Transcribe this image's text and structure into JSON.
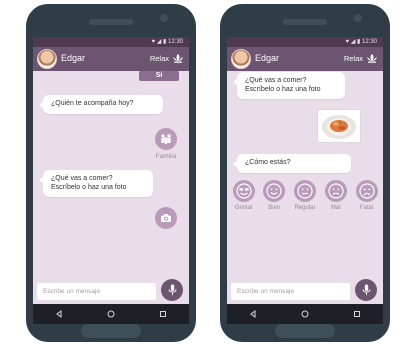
{
  "status": {
    "time": "12:30"
  },
  "header": {
    "contact_name": "Edgar",
    "mode_label": "Relax"
  },
  "left": {
    "reply_chip": "Sí",
    "bubble_1": "¿Quién te acompaña hoy?",
    "family_label": "Familia",
    "bubble_2_line1": "¿Qué vas a comer?",
    "bubble_2_line2": "Escríbelo o haz una foto"
  },
  "right": {
    "bubble_1_line1": "¿Qué vas a comer?",
    "bubble_1_line2": "Escríbelo o haz una foto",
    "bubble_2": "¿Cómo estás?",
    "moods": [
      "Genial",
      "Bien",
      "Regular",
      "Mal",
      "Fatal"
    ]
  },
  "input": {
    "placeholder": "Escribe un mensaje"
  },
  "icons": {
    "status": [
      "heart-icon",
      "signal-icon",
      "battery-icon"
    ],
    "mode": "lotus-icon",
    "family": "family-icon",
    "camera": "camera-icon",
    "mic": "microphone-icon",
    "nav": [
      "back-icon",
      "home-icon",
      "recents-icon"
    ]
  },
  "colors": {
    "appbar": "#6d5470",
    "statusbar": "#4f3a51",
    "chat_background": "#e8dde8",
    "accent_button": "#b99abb",
    "reply_chip": "#8a6d8f",
    "phone_body": "#2f3d47"
  }
}
